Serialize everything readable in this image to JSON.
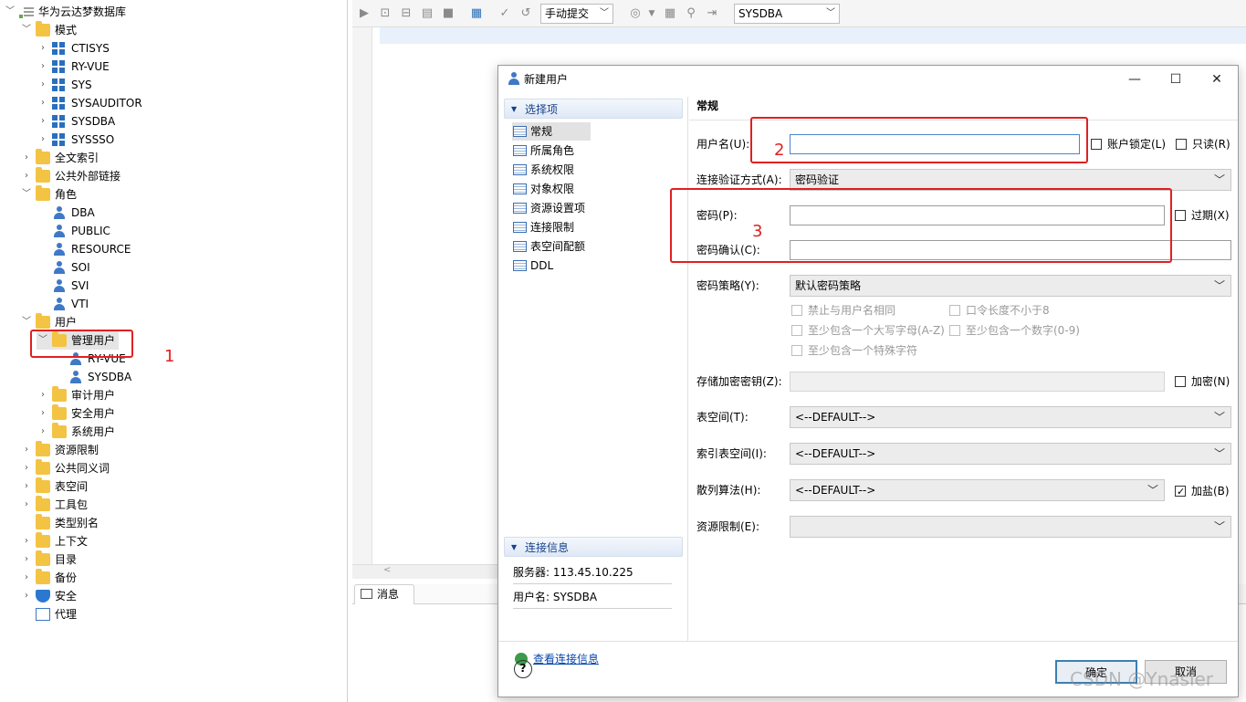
{
  "tree": {
    "root": "华为云达梦数据库",
    "schema_folder": "模式",
    "schemas": [
      "CTISYS",
      "RY-VUE",
      "SYS",
      "SYSAUDITOR",
      "SYSDBA",
      "SYSSSO"
    ],
    "fulltext": "全文索引",
    "public_links": "公共外部链接",
    "roles_folder": "角色",
    "roles": [
      "DBA",
      "PUBLIC",
      "RESOURCE",
      "SOI",
      "SVI",
      "VTI"
    ],
    "users_folder": "用户",
    "admin_users": "管理用户",
    "admin_user_items": [
      "RY-VUE",
      "SYSDBA"
    ],
    "audit_users": "审计用户",
    "security_users": "安全用户",
    "system_users": "系统用户",
    "others": [
      "资源限制",
      "公共同义词",
      "表空间",
      "工具包",
      "类型别名",
      "上下文",
      "目录",
      "备份"
    ],
    "security": "安全",
    "proxy": "代理"
  },
  "annotations": {
    "n1": "1",
    "n2": "2",
    "n3": "3"
  },
  "toolbar": {
    "commit_mode": "手动提交",
    "schema": "SYSDBA"
  },
  "editor": {
    "scroll_marker": "<",
    "messages_tab": "消息"
  },
  "dialog": {
    "title": "新建用户",
    "options_header": "选择项",
    "options": [
      "常规",
      "所属角色",
      "系统权限",
      "对象权限",
      "资源设置项",
      "连接限制",
      "表空间配额",
      "DDL"
    ],
    "conn_header": "连接信息",
    "server": "服务器: 113.45.10.225",
    "user": "用户名: SYSDBA",
    "view_conn": "查看连接信息",
    "general": "常规",
    "username_label": "用户名(U):",
    "username_value": "",
    "lock_account": "账户锁定(L)",
    "read_only": "只读(R)",
    "auth_label": "连接验证方式(A):",
    "auth_value": "密码验证",
    "password_label": "密码(P):",
    "expire": "过期(X)",
    "confirm_label": "密码确认(C):",
    "policy_label": "密码策略(Y):",
    "policy_value": "默认密码策略",
    "policy_opts": [
      "禁止与用户名相同",
      "口令长度不小于8",
      "至少包含一个大写字母(A-Z)",
      "至少包含一个数字(0-9)",
      "至少包含一个特殊字符"
    ],
    "enc_key_label": "存储加密密钥(Z):",
    "encrypt": "加密(N)",
    "tablespace_label": "表空间(T):",
    "tablespace_value": "<--DEFAULT-->",
    "index_ts_label": "索引表空间(I):",
    "index_ts_value": "<--DEFAULT-->",
    "hash_label": "散列算法(H):",
    "hash_value": "<--DEFAULT-->",
    "salt": "加盐(B)",
    "resource_label": "资源限制(E):",
    "ok": "确定",
    "cancel": "取消",
    "help": "?"
  },
  "watermark": "CSDN @Ynasier"
}
